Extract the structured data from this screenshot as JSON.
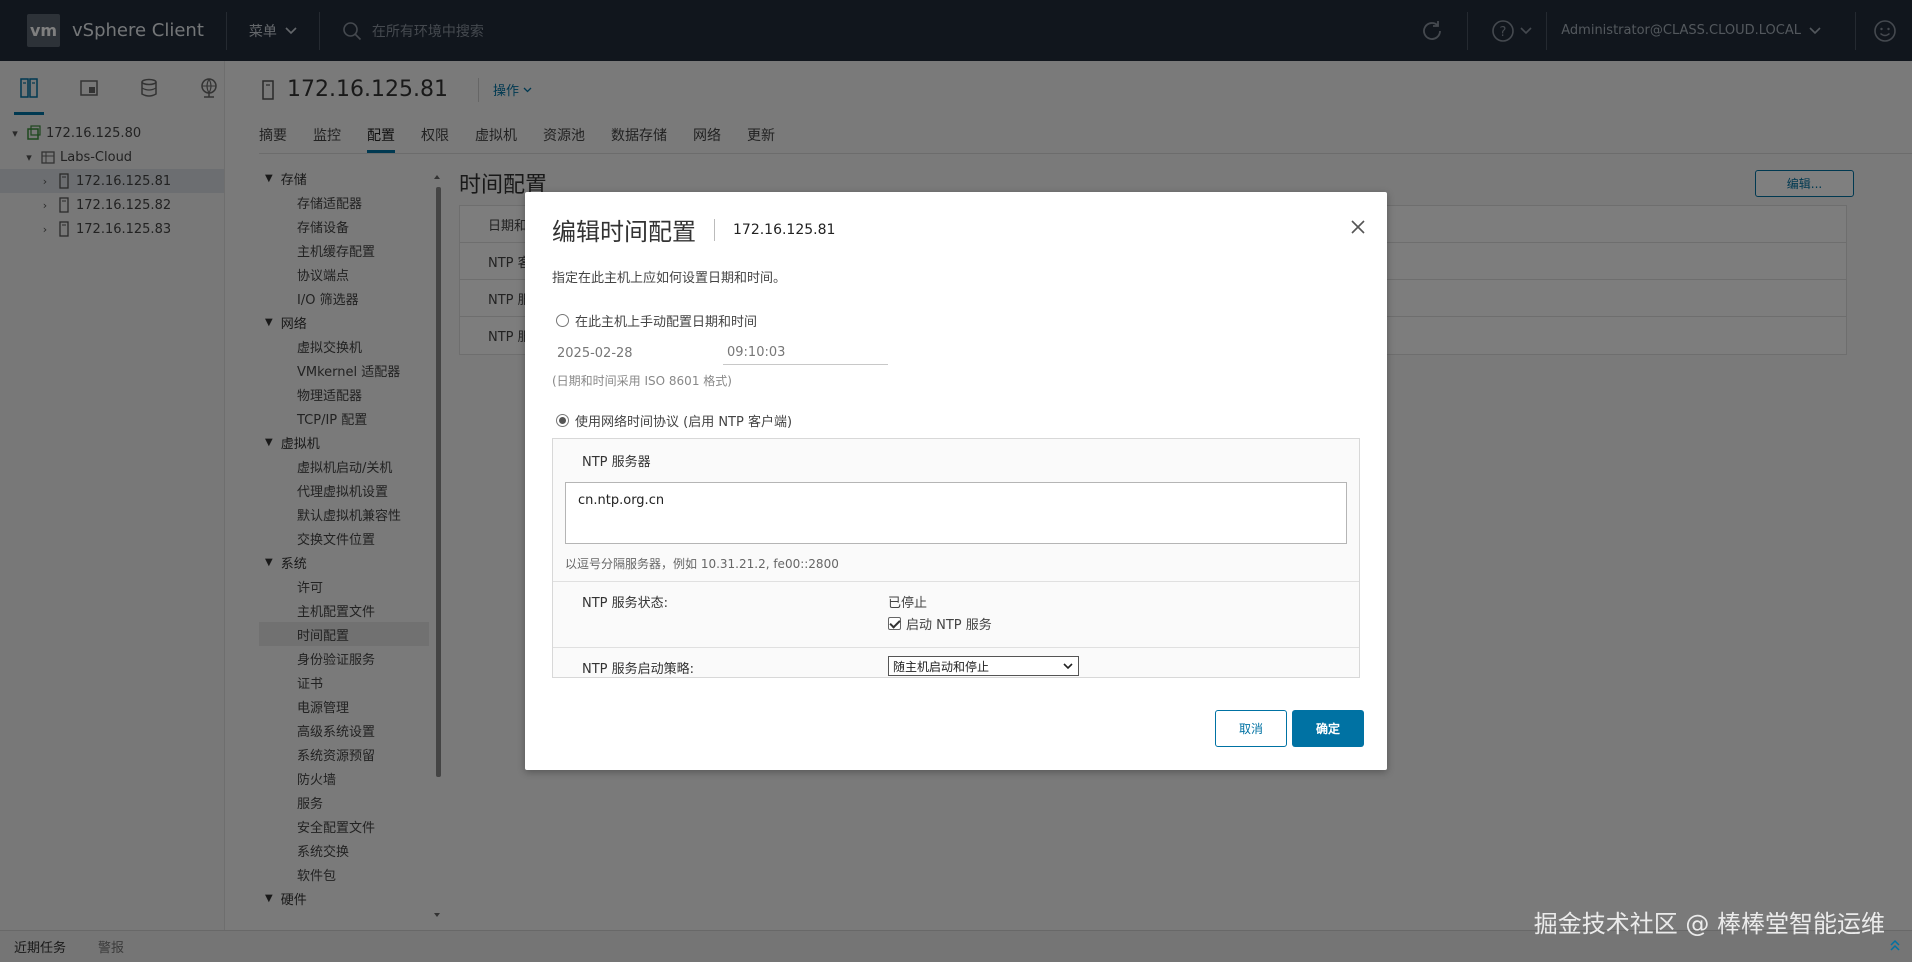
{
  "header": {
    "logo": "vm",
    "app_title": "vSphere Client",
    "menu_label": "菜单",
    "search_placeholder": "在所有环境中搜索",
    "user": "Administrator@CLASS.CLOUD.LOCAL"
  },
  "navigator": {
    "tree": [
      {
        "label": "172.16.125.80",
        "level": 0,
        "icon": "vcenter-icon"
      },
      {
        "label": "Labs-Cloud",
        "level": 1,
        "icon": "datacenter-icon"
      },
      {
        "label": "172.16.125.81",
        "level": 2,
        "icon": "host-icon",
        "selected": true
      },
      {
        "label": "172.16.125.82",
        "level": 2,
        "icon": "host-icon"
      },
      {
        "label": "172.16.125.83",
        "level": 2,
        "icon": "host-icon"
      }
    ]
  },
  "main": {
    "host_title": "172.16.125.81",
    "actions_label": "操作",
    "tabs": [
      "摘要",
      "监控",
      "配置",
      "权限",
      "虚拟机",
      "资源池",
      "数据存储",
      "网络",
      "更新"
    ],
    "active_tab": 2,
    "settings": [
      {
        "group": "存储",
        "items": [
          "存储适配器",
          "存储设备",
          "主机缓存配置",
          "协议端点",
          "I/O 筛选器"
        ]
      },
      {
        "group": "网络",
        "items": [
          "虚拟交换机",
          "VMkernel 适配器",
          "物理适配器",
          "TCP/IP 配置"
        ]
      },
      {
        "group": "虚拟机",
        "items": [
          "虚拟机启动/关机",
          "代理虚拟机设置",
          "默认虚拟机兼容性",
          "交换文件位置"
        ]
      },
      {
        "group": "系统",
        "items": [
          "许可",
          "主机配置文件",
          "时间配置",
          "身份验证服务",
          "证书",
          "电源管理",
          "高级系统设置",
          "系统资源预留",
          "防火墙",
          "服务",
          "安全配置文件",
          "系统交换",
          "软件包"
        ]
      },
      {
        "group": "硬件",
        "items": []
      }
    ],
    "selected_setting": "时间配置",
    "detail_title": "时间配置",
    "edit_button": "编辑...",
    "detail_rows": [
      "日期和",
      "NTP 客",
      "NTP 服",
      "NTP 服"
    ]
  },
  "modal": {
    "title": "编辑时间配置",
    "host": "172.16.125.81",
    "description": "指定在此主机上应如何设置日期和时间。",
    "manual_option": "在此主机上手动配置日期和时间",
    "date_value": "2025-02-28",
    "time_value": "09:10:03",
    "iso_hint": "(日期和时间采用 ISO 8601 格式)",
    "ntp_option": "使用网络时间协议 (启用 NTP 客户端)",
    "ntp_servers_label": "NTP 服务器",
    "ntp_servers_value": "cn.ntp.org.cn",
    "ntp_hint": "以逗号分隔服务器，例如 10.31.21.2, fe00::2800",
    "ntp_status_label": "NTP 服务状态:",
    "ntp_status_value": "已停止",
    "start_ntp_label": "启动 NTP 服务",
    "ntp_policy_label": "NTP 服务启动策略:",
    "ntp_policy_value": "随主机启动和停止",
    "cancel_label": "取消",
    "ok_label": "确定"
  },
  "bottom": {
    "recent_tasks": "近期任务",
    "alarms": "警报"
  },
  "watermark": "掘金技术社区 @ 棒棒堂智能运维",
  "colors": {
    "header_bg": "#222d3b",
    "accent": "#0072a3"
  }
}
